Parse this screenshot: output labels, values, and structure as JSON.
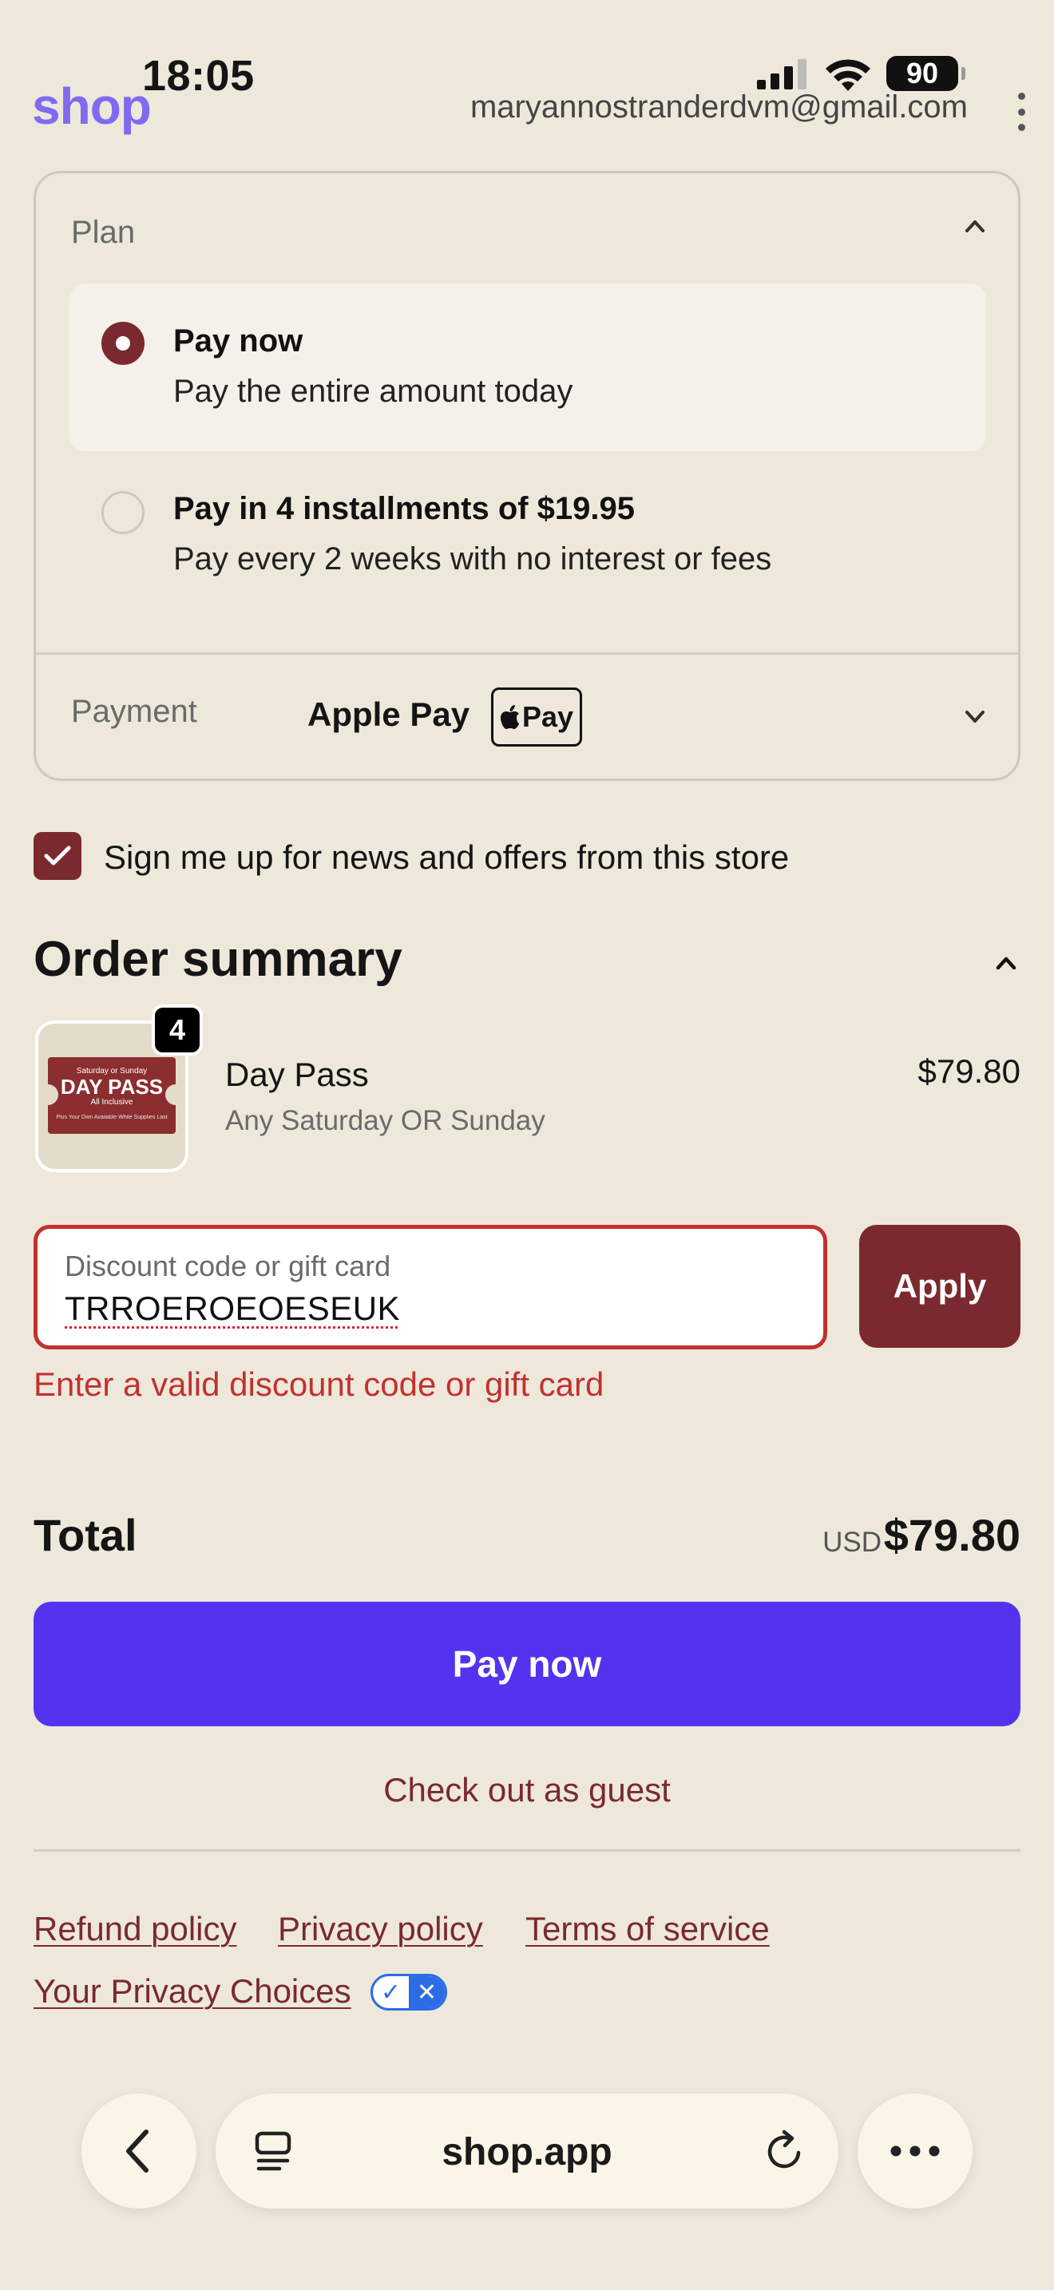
{
  "status_bar": {
    "time": "18:05",
    "battery": "90"
  },
  "header": {
    "logo": "shop",
    "email": "maryannostranderdvm@gmail.com"
  },
  "plan": {
    "label": "Plan",
    "options": [
      {
        "title": "Pay now",
        "subtitle": "Pay the entire amount today",
        "selected": true
      },
      {
        "title": "Pay in 4 installments of $19.95",
        "subtitle": "Pay every 2 weeks with no interest or fees",
        "selected": false
      }
    ]
  },
  "payment": {
    "label": "Payment",
    "method": "Apple Pay",
    "badge": "Pay"
  },
  "newsletter": {
    "label": "Sign me up for news and offers from this store",
    "checked": true
  },
  "order_summary": {
    "title": "Order summary",
    "item": {
      "quantity": "4",
      "name": "Day Pass",
      "variant": "Any Saturday OR Sunday",
      "price": "$79.80",
      "image_text": {
        "top": "Saturday or Sunday",
        "main": "DAY PASS",
        "sub": "All Inclusive",
        "foot": "Plus Your Own Available While Supplies Last"
      }
    }
  },
  "discount": {
    "placeholder": "Discount code or gift card",
    "value": "TRROEROEOESEUK",
    "apply_label": "Apply",
    "error": "Enter a valid discount code or gift card"
  },
  "total": {
    "label": "Total",
    "currency": "USD",
    "amount": "$79.80"
  },
  "actions": {
    "pay_now": "Pay now",
    "guest": "Check out as guest"
  },
  "footer": {
    "refund": "Refund policy",
    "privacy": "Privacy policy",
    "terms": "Terms of service",
    "choices": "Your Privacy Choices"
  },
  "browser": {
    "url": "shop.app"
  },
  "colors": {
    "accent": "#7A2A2E",
    "primary_button": "#5333ED",
    "error": "#C2312F",
    "logo": "#7F6AF0",
    "background": "#EEE8DB"
  }
}
